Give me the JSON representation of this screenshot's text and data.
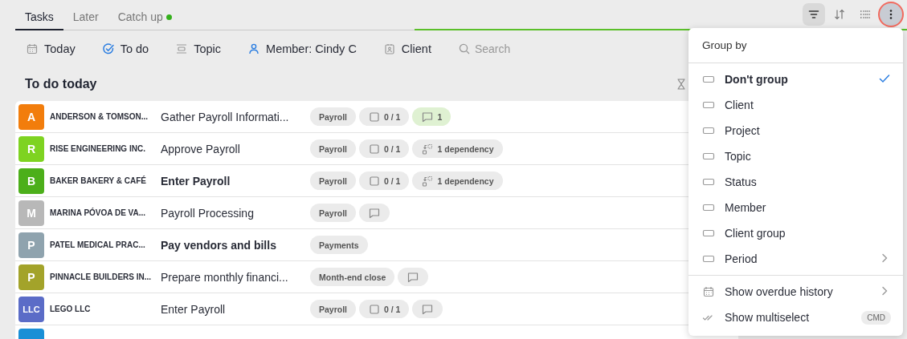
{
  "tabs": [
    {
      "label": "Tasks",
      "selected": true,
      "dot": false
    },
    {
      "label": "Later",
      "selected": false,
      "dot": false
    },
    {
      "label": "Catch up",
      "selected": false,
      "dot": true
    }
  ],
  "toolbar": [
    {
      "kind": "filter",
      "selected": true,
      "highlighted": false
    },
    {
      "kind": "sort",
      "selected": false,
      "highlighted": false
    },
    {
      "kind": "list",
      "selected": false,
      "highlighted": false
    },
    {
      "kind": "more",
      "selected": true,
      "highlighted": true
    }
  ],
  "filters": [
    {
      "kind": "calendar",
      "label": "Today"
    },
    {
      "kind": "todo",
      "label": "To do"
    },
    {
      "kind": "topic",
      "label": "Topic"
    },
    {
      "kind": "member",
      "label": "Member: Cindy C"
    },
    {
      "kind": "client",
      "label": "Client"
    }
  ],
  "search": {
    "placeholder": "Search"
  },
  "section": {
    "title": "To do today"
  },
  "tasks": [
    {
      "initials": "A",
      "color": "#f27d0c",
      "client": "ANDERSON & TOMSON...",
      "title": "Gather Payroll Informati...",
      "emphasized": false,
      "chips": [
        {
          "kind": "tag",
          "text": "Payroll"
        },
        {
          "kind": "checklist",
          "text": "0 / 1"
        },
        {
          "kind": "comment",
          "text": "1",
          "active": true
        }
      ]
    },
    {
      "initials": "R",
      "color": "#7ed321",
      "client": "RISE ENGINEERING INC.",
      "title": "Approve Payroll",
      "emphasized": false,
      "chips": [
        {
          "kind": "tag",
          "text": "Payroll"
        },
        {
          "kind": "checklist",
          "text": "0 / 1"
        },
        {
          "kind": "dependency",
          "text": "1 dependency"
        }
      ]
    },
    {
      "initials": "B",
      "color": "#4caf1a",
      "client": "BAKER BAKERY & CAFÉ",
      "title": "Enter Payroll",
      "emphasized": true,
      "chips": [
        {
          "kind": "tag",
          "text": "Payroll"
        },
        {
          "kind": "checklist",
          "text": "0 / 1"
        },
        {
          "kind": "dependency",
          "text": "1 dependency"
        }
      ]
    },
    {
      "initials": "M",
      "color": "#b8b8b8",
      "client": "MARINA PÓVOA DE VA...",
      "title": "Payroll Processing",
      "emphasized": false,
      "chips": [
        {
          "kind": "tag",
          "text": "Payroll"
        },
        {
          "kind": "comment",
          "active": false
        }
      ]
    },
    {
      "initials": "P",
      "color": "#8fa3ae",
      "client": "PATEL MEDICAL PRAC...",
      "title": "Pay vendors and bills",
      "emphasized": true,
      "chips": [
        {
          "kind": "tag",
          "text": "Payments"
        }
      ]
    },
    {
      "initials": "P",
      "color": "#a3a32a",
      "client": "PINNACLE BUILDERS IN...",
      "title": "Prepare monthly financi...",
      "emphasized": false,
      "chips": [
        {
          "kind": "tag",
          "text": "Month-end close"
        },
        {
          "kind": "comment",
          "active": false
        }
      ]
    },
    {
      "initials": "LLC",
      "color": "#5b6cc7",
      "client": "LEGO LLC",
      "title": "Enter Payroll",
      "emphasized": false,
      "chips": [
        {
          "kind": "tag",
          "text": "Payroll"
        },
        {
          "kind": "checklist",
          "text": "0 / 1"
        },
        {
          "kind": "comment",
          "active": false
        }
      ]
    },
    {
      "color": "#1a8fd6"
    }
  ],
  "menu": {
    "title": "Group by",
    "groups": [
      {
        "kind": "group",
        "label": "Don't group",
        "selected": true,
        "submenu": false
      },
      {
        "kind": "group",
        "label": "Client",
        "selected": false,
        "submenu": false
      },
      {
        "kind": "group",
        "label": "Project",
        "selected": false,
        "submenu": false
      },
      {
        "kind": "group",
        "label": "Topic",
        "selected": false,
        "submenu": false
      },
      {
        "kind": "group",
        "label": "Status",
        "selected": false,
        "submenu": false
      },
      {
        "kind": "group",
        "label": "Member",
        "selected": false,
        "submenu": false
      },
      {
        "kind": "group",
        "label": "Client group",
        "selected": false,
        "submenu": false
      },
      {
        "kind": "group",
        "label": "Period",
        "selected": false,
        "submenu": true
      }
    ],
    "options": [
      {
        "kind": "calendar",
        "label": "Show overdue history",
        "submenu": true
      },
      {
        "kind": "multiselect",
        "label": "Show multiselect",
        "submenu": false,
        "shortcut": "CMD"
      }
    ]
  }
}
